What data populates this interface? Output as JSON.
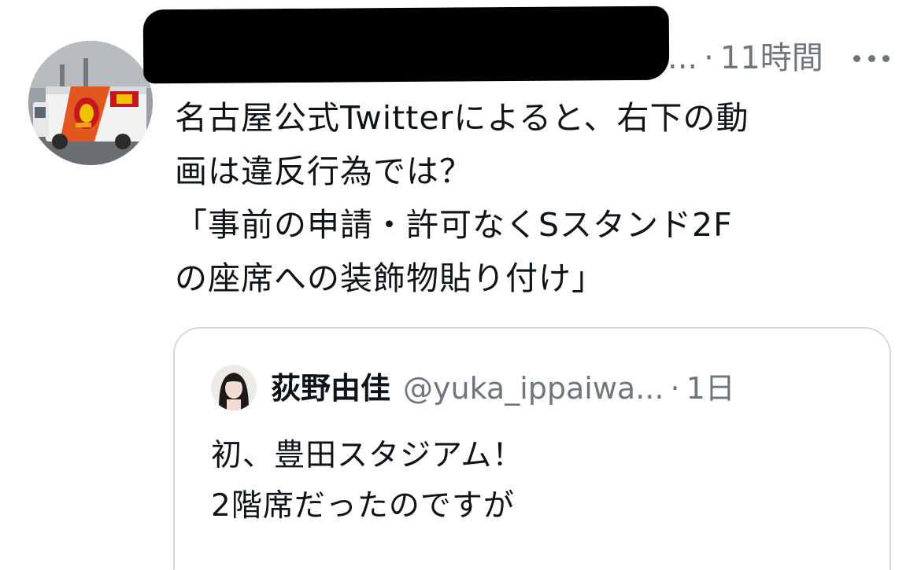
{
  "tweet": {
    "author_truncation": "...",
    "separator": "·",
    "time": "11時間",
    "more_icon": "more-dots-icon",
    "text": "名古屋公式Twitterによると、右下の動\n画は違反行為では？\n「事前の申請・許可なくSスタンド2F\nの座席への装飾物貼り付け」"
  },
  "quote": {
    "display_name": "荻野由佳",
    "handle": "@yuka_ippaiwa...",
    "separator": "·",
    "time": "1日",
    "text": "初、豊田スタジアム！\n2階席だったのですが"
  },
  "colors": {
    "text": "#0f1419",
    "secondary": "#6e767d",
    "border": "#cfd9de",
    "background": "#ffffff"
  }
}
